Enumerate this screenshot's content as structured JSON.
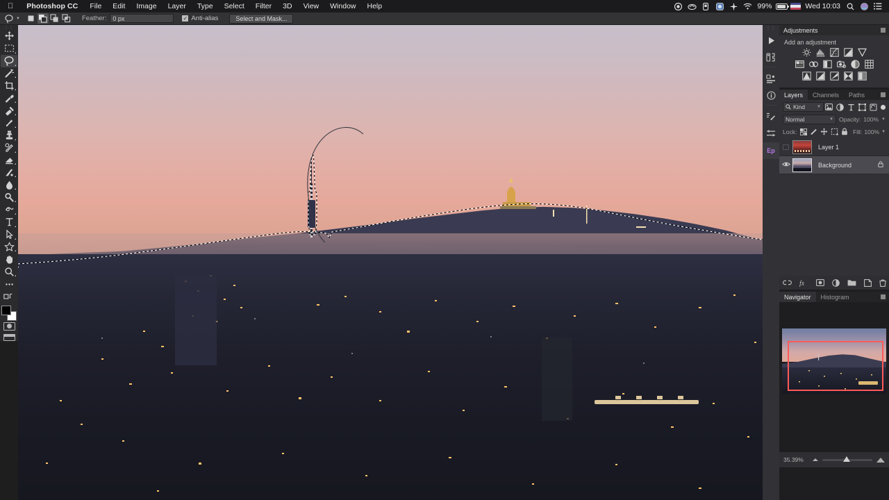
{
  "menubar": {
    "apple": "",
    "app": "Photoshop CC",
    "items": [
      "File",
      "Edit",
      "Image",
      "Layer",
      "Type",
      "Select",
      "Filter",
      "3D",
      "View",
      "Window",
      "Help"
    ],
    "status": {
      "battery_percent": "99%",
      "clock": "Wed 10:03",
      "icons": [
        "record-icon",
        "creative-cloud-icon",
        "dropbox-icon",
        "app-icon",
        "sync-icon",
        "wifi-icon",
        "battery-icon",
        "flag-icon",
        "spotlight-icon",
        "siri-icon",
        "notification-center-icon"
      ]
    }
  },
  "options_bar": {
    "tool_icon": "lasso-icon",
    "selection_modes": [
      "new-selection",
      "add-to-selection",
      "subtract-from-selection",
      "intersect-selection"
    ],
    "active_selection_mode": 1,
    "feather_label": "Feather:",
    "feather_value": "0 px",
    "antialias_label": "Anti-alias",
    "antialias_checked": true,
    "select_and_mask_label": "Select and Mask..."
  },
  "toolbar": {
    "active_tool": "lasso-tool",
    "tools": [
      "move-tool",
      "rectangular-marquee-tool",
      "lasso-tool",
      "magic-wand-tool",
      "crop-tool",
      "eyedropper-tool",
      "spot-healing-brush-tool",
      "brush-tool",
      "clone-stamp-tool",
      "history-brush-tool",
      "eraser-tool",
      "gradient-tool",
      "blur-tool",
      "dodge-tool",
      "pen-tool",
      "type-tool",
      "path-selection-tool",
      "shape-tool",
      "hand-tool",
      "zoom-tool",
      "more-tools"
    ],
    "foreground_color": "#000000",
    "background_color": "#ffffff"
  },
  "panel_rail": {
    "icons": [
      "actions-play-icon",
      "actions-icon",
      "properties-icon",
      "info-icon",
      "brush-settings-icon",
      "adjustments-sliders-icon"
    ],
    "accent_label": "Ep",
    "accent_color": "#b978e8"
  },
  "adjustments_panel": {
    "title": "Adjustments",
    "subtitle": "Add an adjustment",
    "row1": [
      "brightness-contrast-icon",
      "levels-icon",
      "curves-icon",
      "exposure-icon",
      "vibrance-icon"
    ],
    "row2": [
      "hue-saturation-icon",
      "color-balance-icon",
      "black-white-icon",
      "photo-filter-icon",
      "channel-mixer-icon",
      "color-lookup-icon"
    ],
    "row3": [
      "invert-icon",
      "posterize-icon",
      "threshold-icon",
      "selective-color-icon",
      "gradient-map-icon"
    ]
  },
  "layers_panel": {
    "tabs": [
      {
        "label": "Layers",
        "active": true
      },
      {
        "label": "Channels",
        "active": false
      },
      {
        "label": "Paths",
        "active": false
      }
    ],
    "filter_label": "Kind",
    "filter_icons": [
      "pixel-layers-icon",
      "adjustment-layers-icon",
      "type-layers-icon",
      "shape-layers-icon",
      "smart-object-icon"
    ],
    "blend_mode": "Normal",
    "opacity_label": "Opacity:",
    "opacity_value": "100%",
    "lock_label": "Lock:",
    "lock_icons": [
      "lock-transparent-pixels-icon",
      "lock-image-pixels-icon",
      "lock-position-icon",
      "lock-artboard-icon",
      "lock-all-icon"
    ],
    "fill_label": "Fill:",
    "fill_value": "100%",
    "layers": [
      {
        "name": "Layer 1",
        "visible": false,
        "selected": false,
        "locked": false
      },
      {
        "name": "Background",
        "visible": true,
        "selected": true,
        "locked": true
      }
    ],
    "bottom_icons": [
      "link-layers-icon",
      "layer-style-fx-icon",
      "add-layer-mask-icon",
      "new-adjustment-layer-icon",
      "new-group-icon",
      "new-layer-icon",
      "delete-layer-icon"
    ]
  },
  "navigator_panel": {
    "tabs": [
      {
        "label": "Navigator",
        "active": true
      },
      {
        "label": "Histogram",
        "active": false
      }
    ],
    "zoom_value": "35.39%",
    "view_rect_color": "#ff5a5a"
  },
  "canvas": {
    "document": "Barcelona skyline at dusk with Collserola tower",
    "selection_active": true,
    "selection_description": "marching-ants selection along hill ridge and tower",
    "lasso_path_visible": true
  }
}
